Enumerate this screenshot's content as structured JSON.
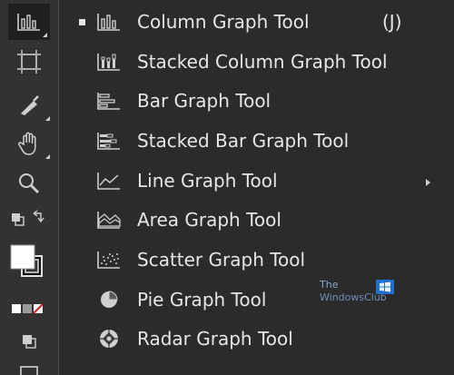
{
  "toolbar": {
    "tools": [
      {
        "name": "column-graph-tool",
        "icon": "column-graph-icon",
        "active": true
      },
      {
        "name": "artboard-tool",
        "icon": "artboard-icon"
      },
      {
        "name": "slice-tool",
        "icon": "slice-knife-icon"
      },
      {
        "name": "hand-tool",
        "icon": "hand-icon"
      },
      {
        "name": "zoom-tool",
        "icon": "zoom-magnifier-icon"
      },
      {
        "name": "swap-fill-stroke",
        "icon": "swap-fill-stroke-icon"
      },
      {
        "name": "fill-stroke-swatch",
        "icon": "fill-stroke-icon"
      },
      {
        "name": "color-none-gradient",
        "icon": "color-modes-icon"
      },
      {
        "name": "draw-mode",
        "icon": "draw-modes-icon"
      }
    ],
    "colors": {
      "bg": "#323232",
      "active_bg": "#1f1f1f",
      "icon": "#cfcfcf"
    }
  },
  "flyout": {
    "items": [
      {
        "label": "Column Graph Tool",
        "icon": "column-graph-icon",
        "checked": true,
        "shortcut": "(J)"
      },
      {
        "label": "Stacked Column Graph Tool",
        "icon": "stacked-column-graph-icon",
        "checked": false,
        "shortcut": ""
      },
      {
        "label": "Bar Graph Tool",
        "icon": "bar-graph-icon",
        "checked": false,
        "shortcut": ""
      },
      {
        "label": "Stacked Bar Graph Tool",
        "icon": "stacked-bar-graph-icon",
        "checked": false,
        "shortcut": ""
      },
      {
        "label": "Line Graph Tool",
        "icon": "line-graph-icon",
        "checked": false,
        "shortcut": ""
      },
      {
        "label": "Area Graph Tool",
        "icon": "area-graph-icon",
        "checked": false,
        "shortcut": ""
      },
      {
        "label": "Scatter Graph Tool",
        "icon": "scatter-graph-icon",
        "checked": false,
        "shortcut": ""
      },
      {
        "label": "Pie Graph Tool",
        "icon": "pie-graph-icon",
        "checked": false,
        "shortcut": ""
      },
      {
        "label": "Radar Graph Tool",
        "icon": "radar-graph-icon",
        "checked": false,
        "shortcut": ""
      }
    ],
    "colors": {
      "bg": "#2b2b2b",
      "text": "#e6e6e6"
    }
  },
  "watermark": {
    "line1": "The",
    "line2": "WindowsClub"
  }
}
